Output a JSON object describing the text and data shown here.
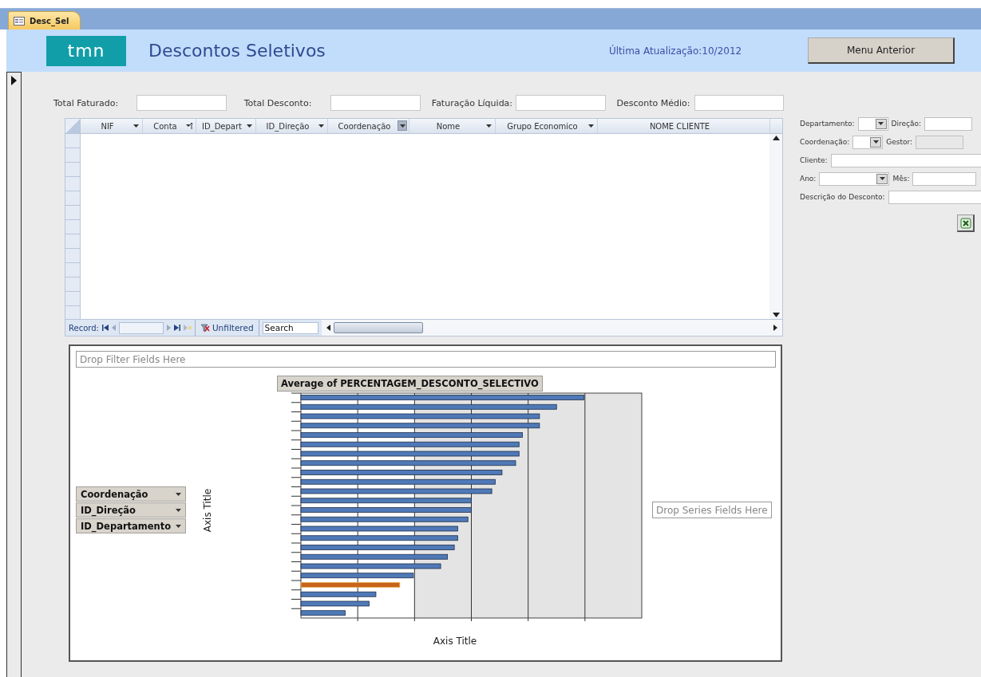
{
  "tab": {
    "label": "Desc_Sel",
    "selected": true
  },
  "header": {
    "logo": "tmn",
    "title": "Descontos Seletivos",
    "last_update": "Última Atualização:10/2012",
    "back_button": "Menu Anterior"
  },
  "totals": [
    {
      "label": "Total Faturado:"
    },
    {
      "label": "Total Desconto:"
    },
    {
      "label": "Faturação Líquida:"
    },
    {
      "label": "Desconto Médio:"
    }
  ],
  "grid": {
    "columns": [
      {
        "label": "NIF",
        "kind": "dropdown",
        "pressed": false
      },
      {
        "label": "Conta",
        "kind": "sorted",
        "pressed": false
      },
      {
        "label": "ID_Depart",
        "kind": "dropdown",
        "pressed": false
      },
      {
        "label": "ID_Direção",
        "kind": "dropdown",
        "pressed": false
      },
      {
        "label": "Coordenação",
        "kind": "dropdown",
        "pressed": true
      },
      {
        "label": "Nome",
        "kind": "dropdown",
        "pressed": false
      },
      {
        "label": "Grupo Economico",
        "kind": "dropdown",
        "pressed": false
      },
      {
        "label": "NOME CLIENTE",
        "kind": "plain",
        "pressed": false
      }
    ],
    "navigation": {
      "record_label": "Record:",
      "filter": "Unfiltered",
      "search": "Search"
    }
  },
  "filters": [
    [
      {
        "label": "Departamento:",
        "kind": "combo",
        "disabled": false
      },
      {
        "label": "Direção:",
        "kind": "text",
        "disabled": false
      }
    ],
    [
      {
        "label": "Coordenação:",
        "kind": "combo",
        "disabled": false
      },
      {
        "label": "Gestor:",
        "kind": "text",
        "disabled": true
      }
    ],
    [
      {
        "label": "Cliente:",
        "kind": "text",
        "disabled": false
      }
    ],
    [
      {
        "label": "Ano:",
        "kind": "combo",
        "disabled": false
      },
      {
        "label": "Mês:",
        "kind": "text",
        "disabled": false
      }
    ],
    [
      {
        "label": "Descrição do Desconto:",
        "kind": "text",
        "disabled": false
      }
    ]
  ],
  "pivot": {
    "filter_drop": "Drop Filter Fields Here",
    "row_fields": [
      "Coordenação",
      "ID_Direção",
      "ID_Departamento"
    ],
    "data_field": "Average of PERCENTAGEM_DESCONTO_SELECTIVO",
    "y_axis_title": "Axis Title",
    "x_axis_title": "Axis Title",
    "series_drop": "Drop Series Fields Here"
  }
}
